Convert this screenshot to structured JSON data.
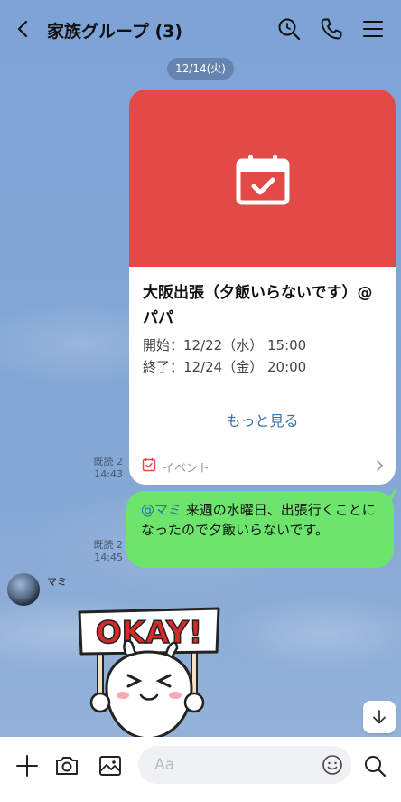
{
  "header": {
    "title": "家族グループ (3)",
    "icons": [
      "back-chevron-icon",
      "search-icon",
      "phone-icon",
      "menu-icon"
    ]
  },
  "date_chip": "12/14(火)",
  "event_card": {
    "title": "大阪出張（夕飯いらないです）@パパ",
    "start": "開始：12/22（水） 15:00",
    "end": "終了：12/24（金） 20:00",
    "more_label": "もっと見る",
    "footer_label": "イベント",
    "accent_color": "#e24a48",
    "read_label": "既読 2",
    "time": "14:43"
  },
  "my_message": {
    "mention": "@マミ",
    "text": " 来週の水曜日、出張行くことになったので夕飯いらないです。",
    "read_label": "既読 2",
    "time": "14:45",
    "bubble_color": "#6de56d"
  },
  "friend_message": {
    "name": "マミ",
    "sticker_text": "OKAY!"
  },
  "input": {
    "placeholder": "Aa"
  }
}
